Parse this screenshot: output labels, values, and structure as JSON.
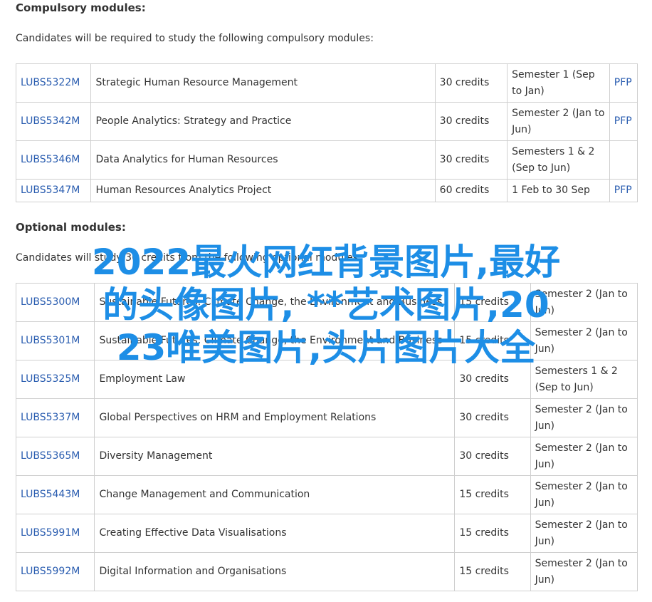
{
  "compulsory": {
    "heading": "Compulsory modules:",
    "intro": "Candidates will be required to study the following compulsory modules:",
    "rows": [
      {
        "code": "LUBS5322M",
        "title": "Strategic Human Resource Management",
        "credits": "30 credits",
        "semester": "Semester 1 (Sep to Jan)",
        "pfp": "PFP"
      },
      {
        "code": "LUBS5342M",
        "title": "People Analytics: Strategy and Practice",
        "credits": "30 credits",
        "semester": "Semester 2 (Jan to Jun)",
        "pfp": "PFP"
      },
      {
        "code": "LUBS5346M",
        "title": "Data Analytics for Human Resources",
        "credits": "30 credits",
        "semester": "Semesters 1 & 2 (Sep to Jun)",
        "pfp": ""
      },
      {
        "code": "LUBS5347M",
        "title": "Human Resources Analytics Project",
        "credits": "60 credits",
        "semester": "1 Feb to 30 Sep",
        "pfp": "PFP"
      }
    ]
  },
  "optional": {
    "heading": "Optional modules:",
    "intro": "Candidates will study 30 credits from the following optional modules:",
    "rows": [
      {
        "code": "LUBS5300M",
        "title": "Sustainable Futures: Climate Change, the Environment and Business",
        "credits": "15 credits",
        "semester": "Semester 2 (Jan to Jun)"
      },
      {
        "code": "LUBS5301M",
        "title": "Sustainable Futures: Climate Change, the Environment and Business",
        "credits": "15 credits",
        "semester": "Semester 2 (Jan to Jun)"
      },
      {
        "code": "LUBS5325M",
        "title": "Employment Law",
        "credits": "30 credits",
        "semester": "Semesters 1 & 2 (Sep to Jun)"
      },
      {
        "code": "LUBS5337M",
        "title": "Global Perspectives on HRM and Employment Relations",
        "credits": "30 credits",
        "semester": "Semester 2 (Jan to Jun)"
      },
      {
        "code": "LUBS5365M",
        "title": "Diversity Management",
        "credits": "30 credits",
        "semester": "Semester 2 (Jan to Jun)"
      },
      {
        "code": "LUBS5443M",
        "title": "Change Management and Communication",
        "credits": "15 credits",
        "semester": "Semester 2 (Jan to Jun)"
      },
      {
        "code": "LUBS5991M",
        "title": "Creating Effective Data Visualisations",
        "credits": "15 credits",
        "semester": "Semester 2 (Jan to Jun)"
      },
      {
        "code": "LUBS5992M",
        "title": "Digital Information and Organisations",
        "credits": "15 credits",
        "semester": "Semester 2 (Jan to Jun)"
      }
    ]
  },
  "overlay": {
    "line1": "2022最火网红背景图片,最好",
    "line2": "的头像图片, **艺术图片,20",
    "line3": "23唯美图片,头片图片大全"
  },
  "colors": {
    "link": "#2a5db0",
    "overlay": "#1d8ee6",
    "border": "#cfcfcf"
  }
}
